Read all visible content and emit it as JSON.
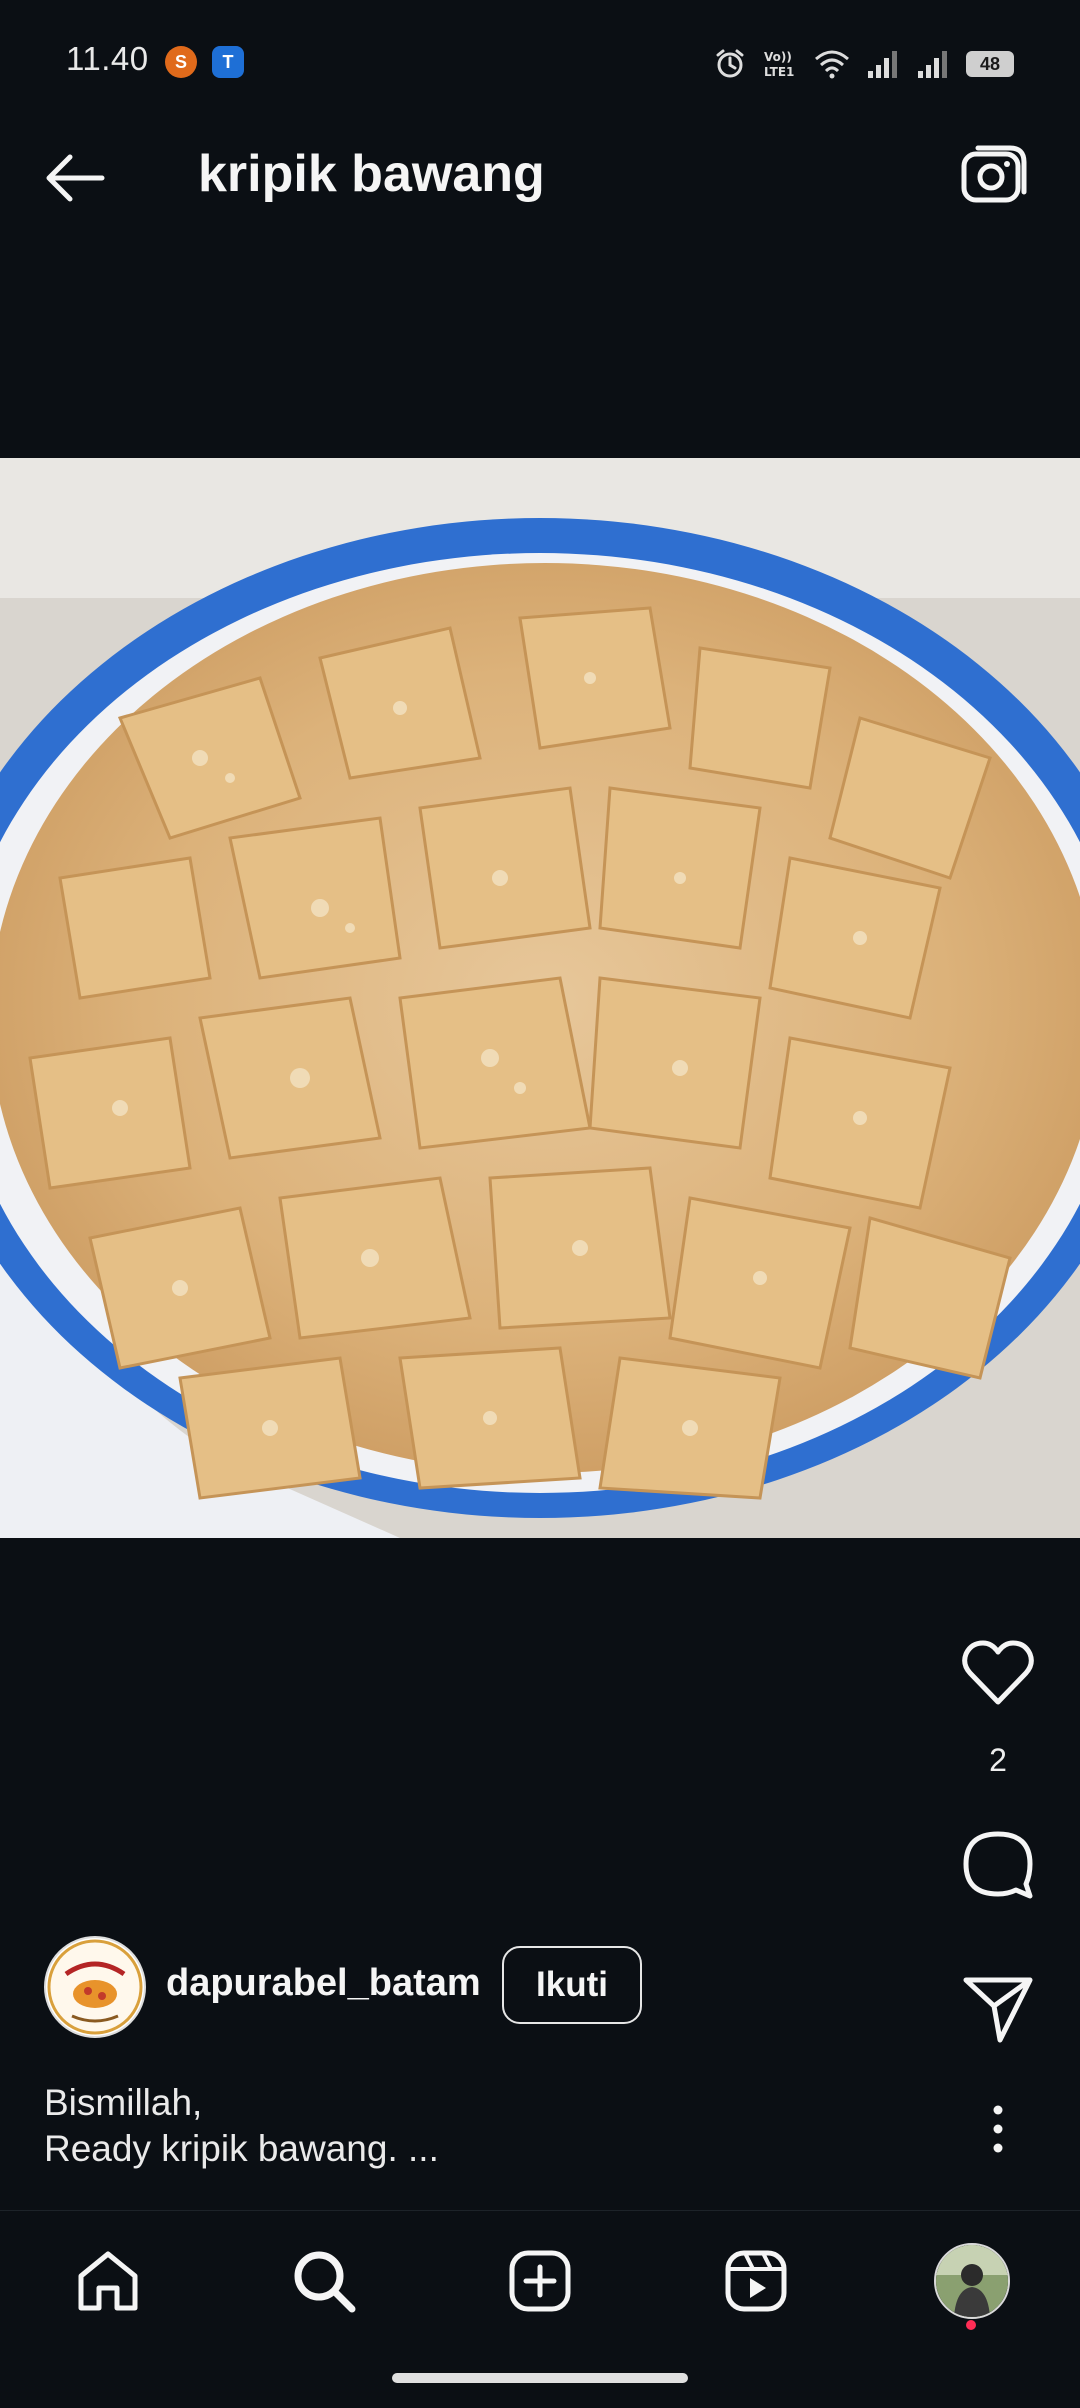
{
  "status_bar": {
    "time": "11.40",
    "app_badges": [
      {
        "letter": "S",
        "color": "#e06a1b"
      },
      {
        "letter": "T",
        "color": "#1e6fd6"
      }
    ],
    "battery": "48"
  },
  "header": {
    "title": "kripik bawang"
  },
  "post": {
    "like_count": "2",
    "username": "dapurabel_batam",
    "follow_label": "Ikuti",
    "caption_line1": "Bismillah,",
    "caption_line2": "Ready kripik bawang. ..."
  },
  "colors": {
    "background": "#0b0f14",
    "text": "#f4f4f4",
    "notification_dot": "#ff2d55"
  },
  "icons": {
    "back": "arrow-left-icon",
    "camera": "camera-icon",
    "like": "heart-icon",
    "comment": "comment-icon",
    "share": "send-icon",
    "more": "more-vertical-icon",
    "nav": [
      "home-icon",
      "search-icon",
      "add-icon",
      "reels-icon",
      "profile-avatar"
    ]
  }
}
